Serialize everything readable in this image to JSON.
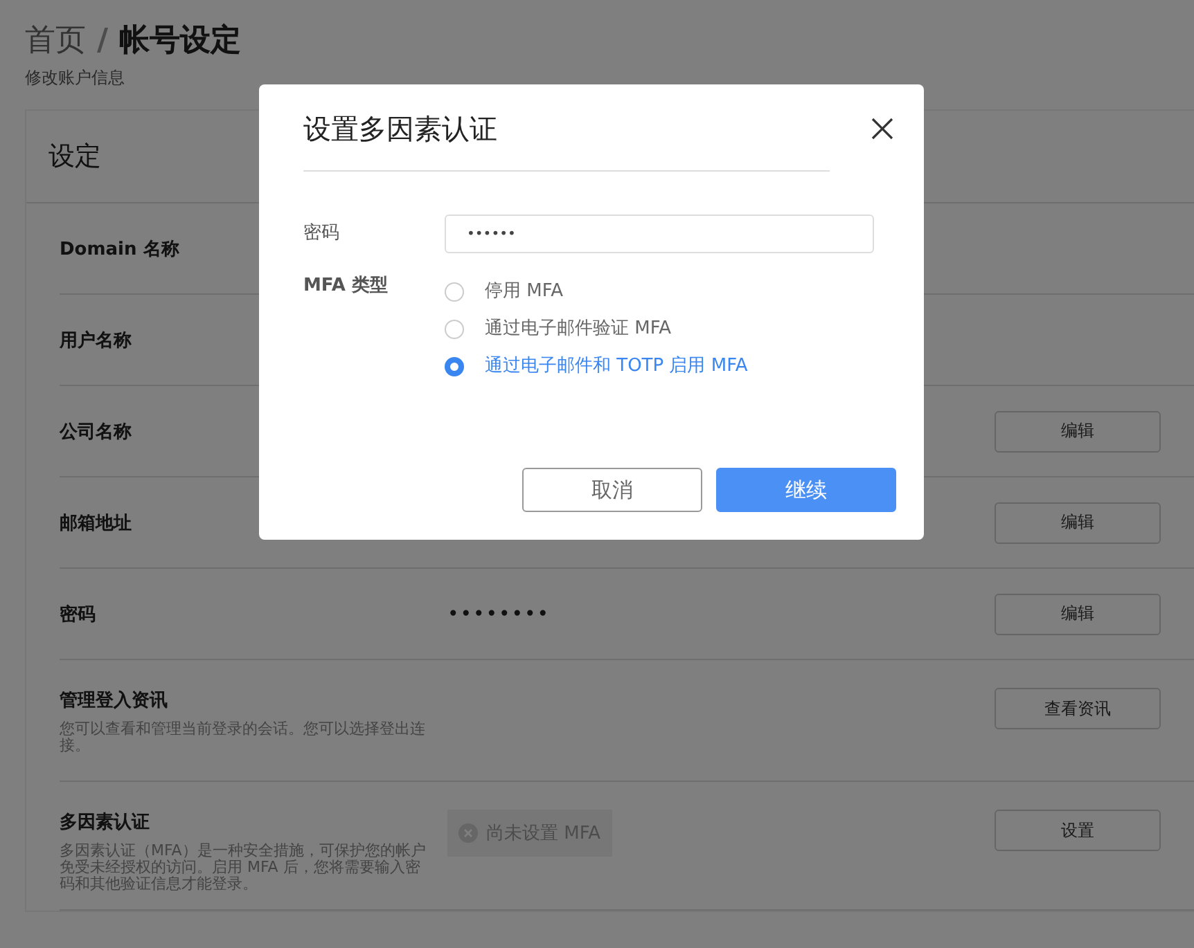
{
  "breadcrumb": {
    "parent": "首页",
    "separator": "/",
    "current": "帐号设定"
  },
  "subtitle": "修改账户信息",
  "card": {
    "title": "设定",
    "rows": [
      {
        "kind": "plain",
        "label": "Domain 名称"
      },
      {
        "kind": "plain",
        "label": "用户名称"
      },
      {
        "kind": "plain",
        "label": "公司名称",
        "button": "编辑"
      },
      {
        "kind": "plain",
        "label": "邮箱地址",
        "button": "编辑"
      },
      {
        "kind": "secret",
        "label": "密码",
        "value": "••••••••",
        "button": "编辑"
      },
      {
        "kind": "plain",
        "label": "管理登入资讯",
        "description": "您可以查看和管理当前登录的会话。您可以选择登出连接。",
        "button": "查看资讯"
      },
      {
        "kind": "status",
        "label": "多因素认证",
        "description": "多因素认证（MFA）是一种安全措施，可保护您的帐户免受未经授权的访问。启用 MFA 后，您将需要输入密码和其他验证信息才能登录。",
        "value": "尚未设置 MFA",
        "button": "设置"
      }
    ]
  },
  "dialog": {
    "title": "设置多因素认证",
    "password": {
      "label": "密码",
      "value": "••••••"
    },
    "mfa_type": {
      "label": "MFA 类型",
      "options": [
        {
          "label": "停用 MFA",
          "selected": false
        },
        {
          "label": "通过电子邮件验证 MFA",
          "selected": false
        },
        {
          "label": "通过电子邮件和 TOTP 启用 MFA",
          "selected": true
        }
      ]
    },
    "buttons": [
      {
        "kind": "secondary",
        "label": "取消"
      },
      {
        "kind": "primary",
        "label": "继续"
      }
    ]
  }
}
